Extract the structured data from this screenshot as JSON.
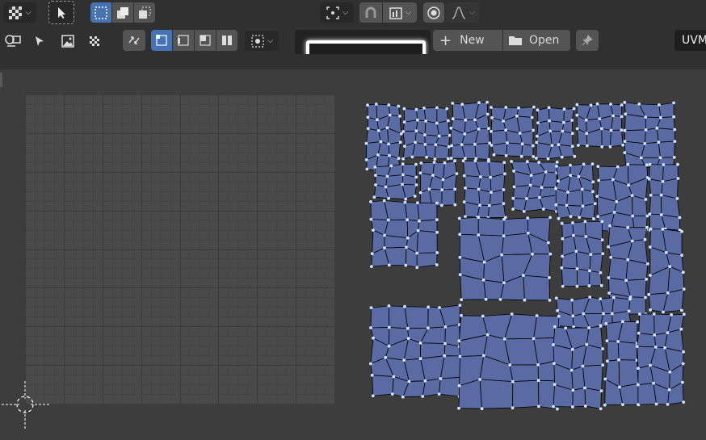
{
  "header": {
    "new_label": "New",
    "open_label": "Open",
    "uv_map_label": "UVM"
  },
  "icons": {
    "editor_type": "checker-grid-icon",
    "tool_select": "cursor-select-icon",
    "select_box": "box-select-icon",
    "pivot": "pivot-icon",
    "snap": "magnet-snap-icon",
    "proportional": "proportional-edit-icon",
    "falloff": "falloff-curve-icon",
    "uv_sync": "uv-sync-icon",
    "new_plus": "plus-icon",
    "open_folder": "folder-icon",
    "pin": "pin-icon",
    "cursor_2d": "2d-cursor-icon"
  },
  "colors": {
    "header_bg": "#303030",
    "viewport_bg": "#3d3d3d",
    "grid_bg": "#4a4a4a",
    "uv_face": "#5a6aa3",
    "uv_vertex": "#cfe4ff",
    "accent": "#4772b3"
  }
}
